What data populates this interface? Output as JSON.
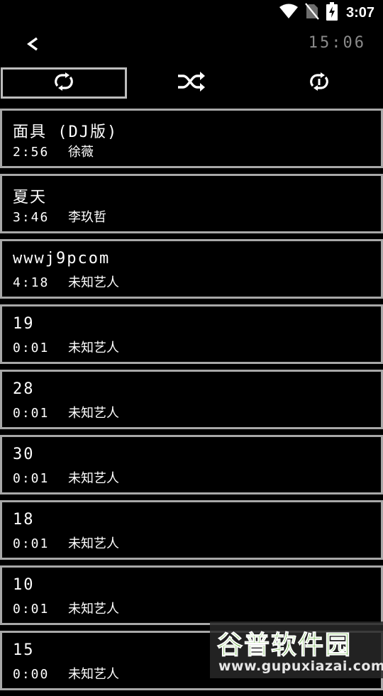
{
  "status_bar": {
    "time": "3:07",
    "icons": [
      "wifi-icon",
      "no-sim-icon",
      "battery-charging-icon"
    ]
  },
  "header": {
    "back_icon": "chevron-left-icon",
    "clock": "15:06"
  },
  "modes": [
    {
      "icon": "repeat-all-icon",
      "selected": true
    },
    {
      "icon": "shuffle-icon",
      "selected": false
    },
    {
      "icon": "repeat-one-icon",
      "selected": false
    }
  ],
  "songs": [
    {
      "title": "面具 (DJ版)",
      "duration": "2:56",
      "artist": "徐薇"
    },
    {
      "title": "夏天",
      "duration": "3:46",
      "artist": "李玖哲"
    },
    {
      "title": "wwwj9pcom",
      "duration": "4:18",
      "artist": "未知艺人"
    },
    {
      "title": "19",
      "duration": "0:01",
      "artist": "未知艺人"
    },
    {
      "title": "28",
      "duration": "0:01",
      "artist": "未知艺人"
    },
    {
      "title": "30",
      "duration": "0:01",
      "artist": "未知艺人"
    },
    {
      "title": "18",
      "duration": "0:01",
      "artist": "未知艺人"
    },
    {
      "title": "10",
      "duration": "0:01",
      "artist": "未知艺人"
    },
    {
      "title": "15",
      "duration": "0:00",
      "artist": "未知艺人"
    }
  ],
  "watermark": {
    "title": "谷普软件园",
    "url": "www.gupuxiazai.com"
  },
  "colors": {
    "background": "#000000",
    "border": "#a8a8a8",
    "clock": "#8a8a8a",
    "text": "#ffffff"
  }
}
